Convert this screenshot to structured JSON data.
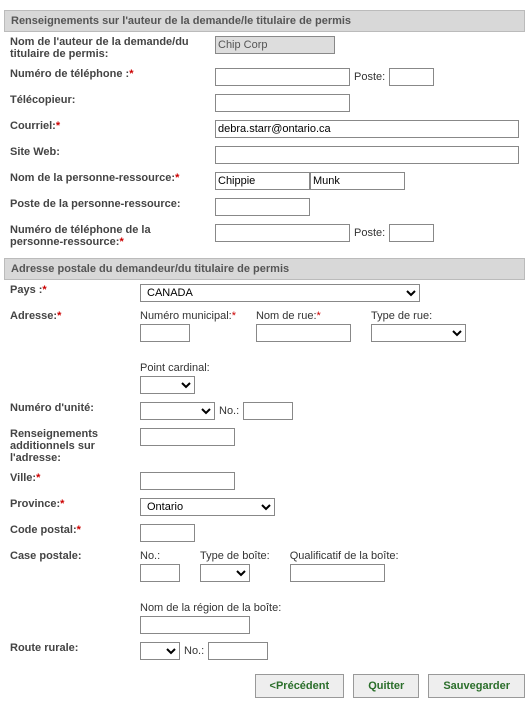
{
  "section1": {
    "title": "Renseignements sur l'auteur de la demande/le titulaire de permis",
    "fields": {
      "name_label": "Nom de l'auteur de la demande/du titulaire de permis:",
      "name_value": "Chip Corp",
      "phone_label": "Numéro de téléphone :",
      "phone_value": "",
      "ext_label": "Poste:",
      "ext_value": "",
      "fax_label": "Télécopieur:",
      "fax_value": "",
      "email_label": "Courriel:",
      "email_value": "debra.starr@ontario.ca",
      "website_label": "Site Web:",
      "website_value": "",
      "contact_name_label": "Nom de la personne-ressource:",
      "contact_first": "Chippie",
      "contact_last": "Munk",
      "contact_title_label": "Poste de la personne-ressource:",
      "contact_title_value": "",
      "contact_phone_label": "Numéro de téléphone de la personne-ressource:",
      "contact_phone_value": "",
      "contact_ext_label": "Poste:",
      "contact_ext_value": ""
    }
  },
  "section2": {
    "title": "Adresse postale du demandeur/du titulaire de permis",
    "fields": {
      "country_label": "Pays :",
      "country_value": "CANADA",
      "address_label": "Adresse:",
      "street_num_label": "Numéro municipal:",
      "street_num_value": "",
      "street_name_label": "Nom de rue:",
      "street_name_value": "",
      "street_type_label": "Type de rue:",
      "street_type_value": "",
      "direction_label": "Point cardinal:",
      "direction_value": "",
      "unit_label": "Numéro d'unité:",
      "unit_type_value": "",
      "unit_no_label": "No.:",
      "unit_no_value": "",
      "extra_label": "Renseignements additionnels sur l'adresse:",
      "extra_value": "",
      "city_label": "Ville:",
      "city_value": "",
      "province_label": "Province:",
      "province_value": "Ontario",
      "postal_label": "Code postal:",
      "postal_value": "",
      "pobox_label": "Case postale:",
      "pobox_no_label": "No.:",
      "pobox_no_value": "",
      "pobox_type_label": "Type de boîte:",
      "pobox_type_value": "",
      "pobox_qual_label": "Qualificatif de la boîte:",
      "pobox_qual_value": "",
      "pobox_area_label": "Nom de la région de la boîte:",
      "pobox_area_value": "",
      "rural_label": "Route rurale:",
      "rural_type_value": "",
      "rural_no_label": "No.:",
      "rural_no_value": ""
    }
  },
  "footer": {
    "prev": "<Précédent",
    "quit": "Quitter",
    "save": "Sauvegarder"
  }
}
